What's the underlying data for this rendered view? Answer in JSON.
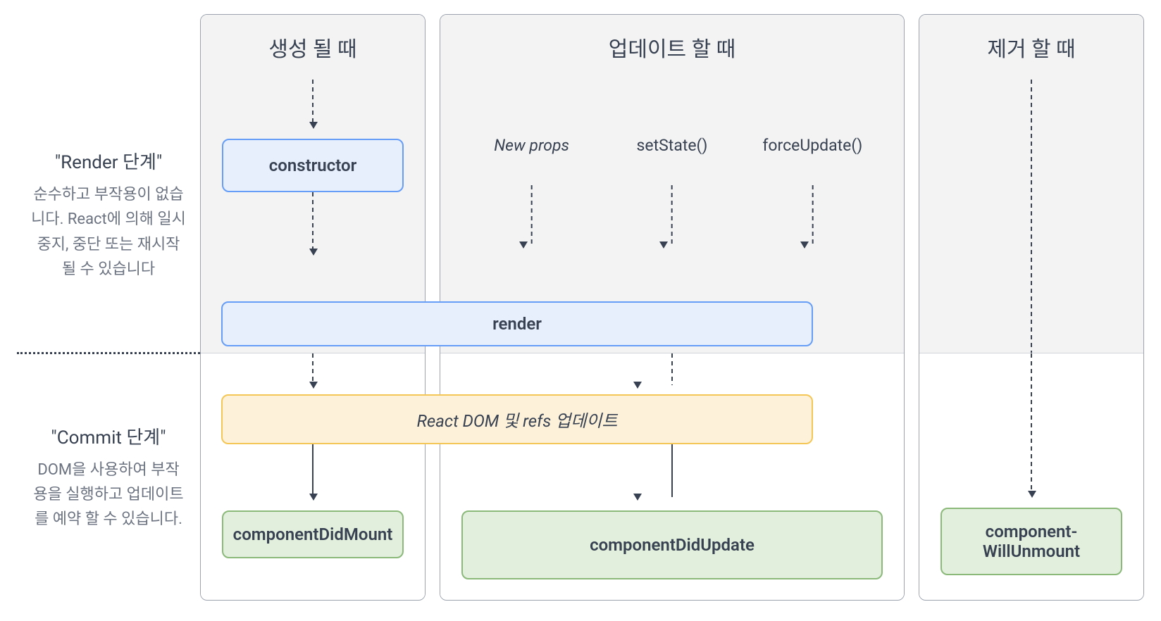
{
  "phases": {
    "render": {
      "title": "\"Render 단계\"",
      "description": "순수하고 부작용이 없습니다. React에 의해 일시 중지, 중단 또는 재시작 될 수 있습니다"
    },
    "commit": {
      "title": "\"Commit 단계\"",
      "description": "DOM을 사용하여 부작용을 실행하고 업데이트를 예약 할 수 있습니다."
    }
  },
  "columns": {
    "mount": {
      "header": "생성 될 때",
      "constructor": "constructor",
      "didMount": "component­DidMount"
    },
    "update": {
      "header": "업데이트 할 때",
      "triggers": {
        "newProps": "New props",
        "setState": "setState()",
        "forceUpdate": "force­Update()"
      },
      "didUpdate": "componentDidUpdate"
    },
    "unmount": {
      "header": "제거 할 때",
      "willUnmount": "component­WillUnmount"
    }
  },
  "shared": {
    "render": "render",
    "reactDomUpdate": "React DOM 및 refs 업데이트"
  }
}
